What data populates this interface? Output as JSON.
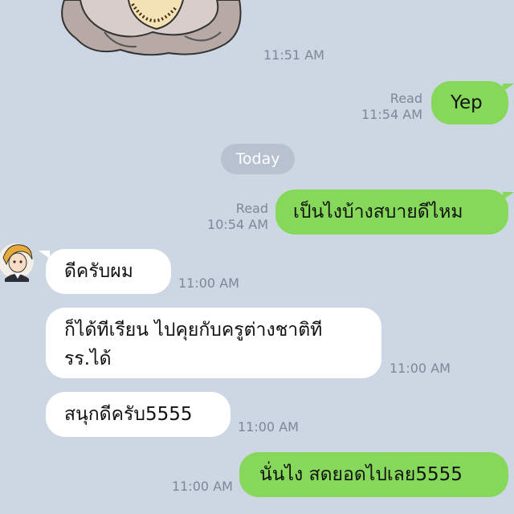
{
  "chat": {
    "sticker_time": "11:51 AM",
    "msg1": {
      "text": "Yep",
      "read": "Read",
      "time": "11:54 AM"
    },
    "date_separator": "Today",
    "msg2": {
      "text": "เป็นไงบ้างสบายดีไหม",
      "read": "Read",
      "time": "10:54 AM"
    },
    "msg3": {
      "text": "ดีครับผม",
      "time": "11:00 AM"
    },
    "msg4": {
      "line1": "ก็ได้ทีเรียน ไปคุยกับครูต่างชาติที",
      "line2": "รร.ได้",
      "time": "11:00 AM"
    },
    "msg5": {
      "text": "สนุกดีครับ5555",
      "time": "11:00 AM"
    },
    "msg6": {
      "text": "นั่นไง สดยอดไปเลย5555",
      "time": "11:00 AM"
    }
  },
  "icons": {
    "sticker": "flower-sticker",
    "avatar": "anime-avatar"
  },
  "colors": {
    "background": "#cdd6e3",
    "outgoing": "#86d85a",
    "incoming": "#ffffff",
    "meta": "#7d8799"
  }
}
